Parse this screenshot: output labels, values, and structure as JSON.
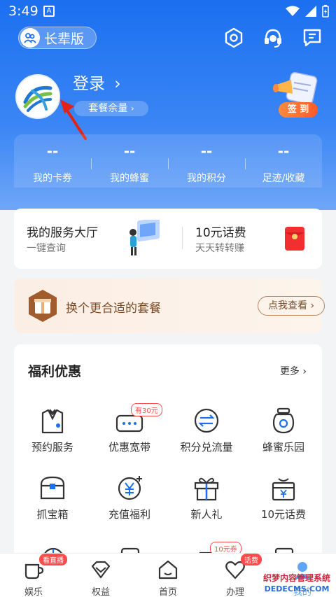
{
  "status_bar": {
    "time": "3:49",
    "notif_letter": "A"
  },
  "header": {
    "elder_mode_label": "长辈版",
    "settings_icon": "gear-icon",
    "service_icon": "headset-icon",
    "message_icon": "chat-icon"
  },
  "profile": {
    "login_label": "登录",
    "package_balance_label": "套餐余量",
    "checkin_label": "签 到"
  },
  "stats": [
    {
      "value": "--",
      "label": "我的卡券"
    },
    {
      "value": "--",
      "label": "我的蜂蜜"
    },
    {
      "value": "--",
      "label": "我的积分"
    },
    {
      "value": "--",
      "label": "足迹/收藏"
    }
  ],
  "services": {
    "hall_title": "我的服务大厅",
    "hall_sub": "一键查询",
    "bill_title": "10元话费",
    "bill_sub": "天天转转赚"
  },
  "plan_banner": {
    "text": "换个更合适的套餐",
    "button": "点我查看"
  },
  "welfare": {
    "title": "福利优惠",
    "more": "更多",
    "items": [
      {
        "label": "预约服务",
        "icon": "suit-icon"
      },
      {
        "label": "优惠宽带",
        "icon": "router-icon",
        "tag": "有30元"
      },
      {
        "label": "积分兑流量",
        "icon": "exchange-icon"
      },
      {
        "label": "蜂蜜乐园",
        "icon": "honey-jar-icon"
      },
      {
        "label": "抓宝箱",
        "icon": "treasure-box-icon"
      },
      {
        "label": "充值福利",
        "icon": "yen-coin-icon"
      },
      {
        "label": "新人礼",
        "icon": "gift-icon"
      },
      {
        "label": "10元话费",
        "icon": "yen-gift-icon"
      }
    ],
    "partial_row_tag": "10元券"
  },
  "tabbar": {
    "tabs": [
      {
        "label": "娱乐",
        "icon": "cup-icon",
        "badge": "看直播"
      },
      {
        "label": "权益",
        "icon": "diamond-icon"
      },
      {
        "label": "首页",
        "icon": "home-icon"
      },
      {
        "label": "办理",
        "icon": "heart-icon",
        "badge": "话费"
      },
      {
        "label": "我的",
        "icon": "user-icon"
      }
    ]
  },
  "watermark": {
    "line1": "织梦内容管理系统",
    "line2": "DEDECMS.COM"
  },
  "colors": {
    "primary": "#1b6ff0",
    "accent_red": "#ff4d4d",
    "plan_brown": "#7a4b28"
  }
}
